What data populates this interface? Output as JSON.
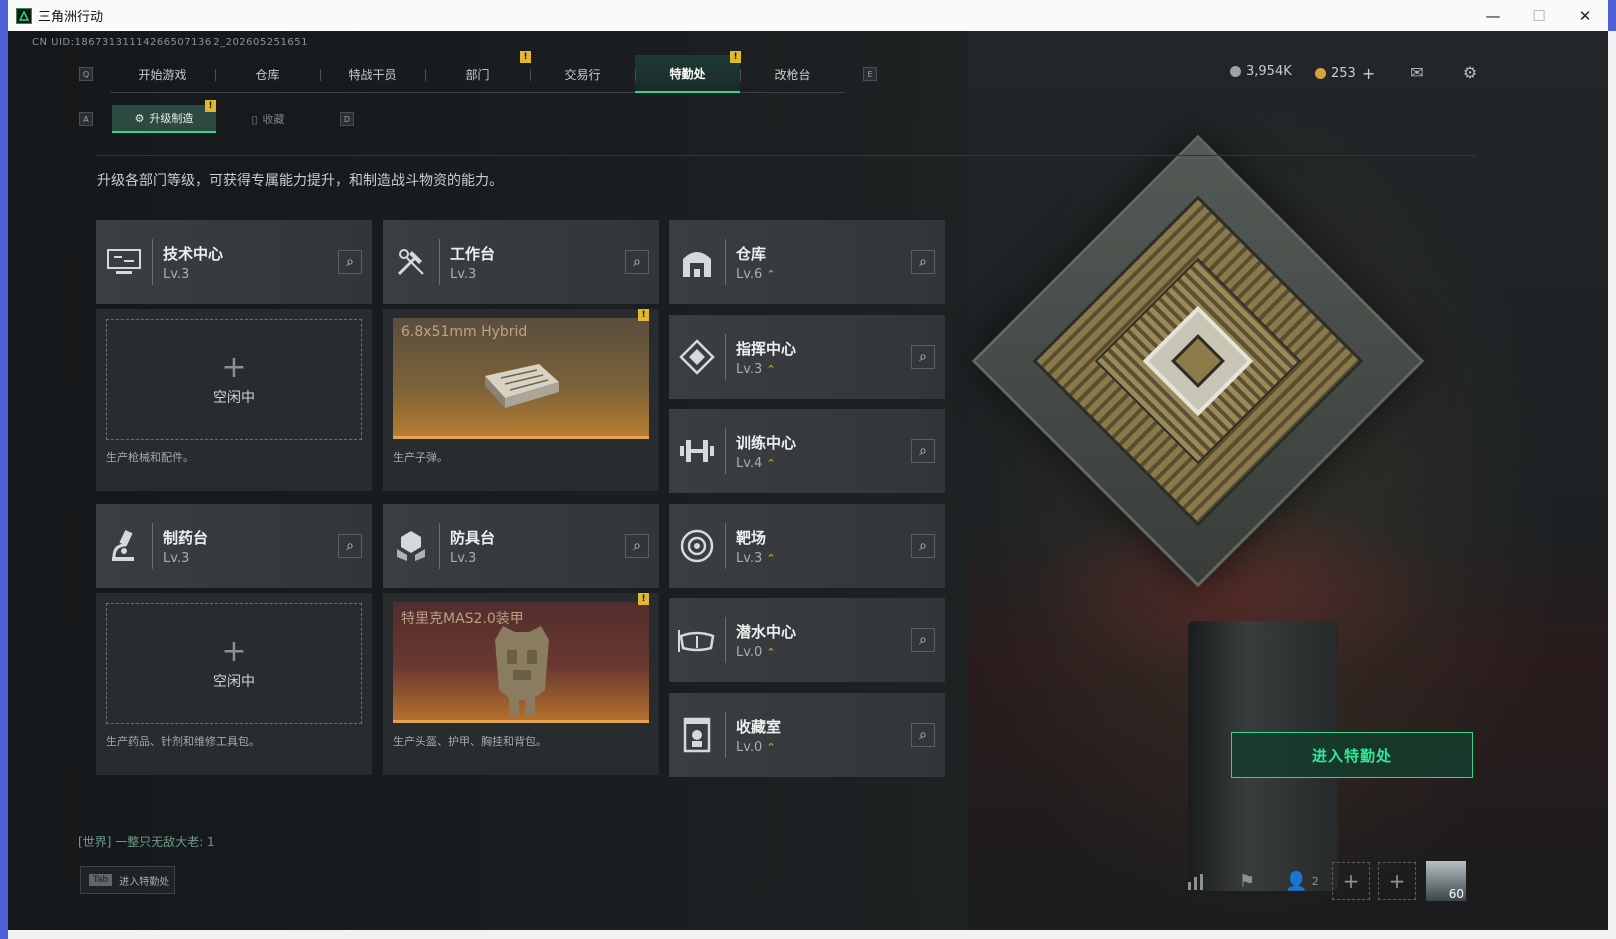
{
  "window": {
    "title": "三角洲行动",
    "minimize": "—",
    "maximize": "☐",
    "close": "✕"
  },
  "uid": "CN UID:18673131114266507136 2_202605251651",
  "nav": {
    "key_left": "Q",
    "key_right": "E",
    "tabs": [
      {
        "label": "开始游戏"
      },
      {
        "label": "仓库"
      },
      {
        "label": "特战干员"
      },
      {
        "label": "部门"
      },
      {
        "label": "交易行"
      },
      {
        "label": "特勤处"
      },
      {
        "label": "改枪台"
      }
    ]
  },
  "currency": {
    "coins": "3,954K",
    "tokens": "253",
    "add": "+"
  },
  "subnav": {
    "key_left": "A",
    "key_right": "D",
    "active": "升级制造",
    "other": "收藏"
  },
  "description": "升级各部门等级，可获得专属能力提升，和制造战斗物资的能力。",
  "facilities": [
    {
      "name": "技术中心",
      "level": "Lv.3",
      "icon": "monitor-icon"
    },
    {
      "name": "工作台",
      "level": "Lv.3",
      "icon": "tools-icon"
    },
    {
      "name": "仓库",
      "level": "Lv.6",
      "icon": "warehouse-icon",
      "upgradable": "⌃"
    },
    {
      "name": "指挥中心",
      "level": "Lv.3",
      "icon": "command-icon",
      "upgradable": "⌃"
    },
    {
      "name": "训练中心",
      "level": "Lv.4",
      "icon": "dumbbell-icon",
      "upgradable": "⌃"
    },
    {
      "name": "制药台",
      "level": "Lv.3",
      "icon": "microscope-icon"
    },
    {
      "name": "防具台",
      "level": "Lv.3",
      "icon": "armor-icon"
    },
    {
      "name": "靶场",
      "level": "Lv.3",
      "icon": "target-icon",
      "upgradable": "⌃"
    },
    {
      "name": "潜水中心",
      "level": "Lv.0",
      "icon": "diving-icon",
      "upgradable": "⌃"
    },
    {
      "name": "收藏室",
      "level": "Lv.0",
      "icon": "collection-icon",
      "upgradable": "⌃"
    }
  ],
  "slots": {
    "tech": {
      "status": "空闲中",
      "caption": "生产枪械和配件。"
    },
    "workbench": {
      "item": "6.8x51mm Hybrid",
      "caption": "生产子弹。"
    },
    "pharmacy": {
      "status": "空闲中",
      "caption": "生产药品、针剂和维修工具包。"
    },
    "armor": {
      "item": "特里克MAS2.0装甲",
      "caption": "生产头盔、护甲、胸挂和背包。"
    }
  },
  "alert_mark": "!",
  "chat": {
    "channel": "[世界]",
    "message": "一整只无敌大老: 1"
  },
  "tab_hint": {
    "key": "Tab",
    "label": "进入特勤处"
  },
  "enter_button": "进入特勤处",
  "bottom": {
    "friends_count": "2",
    "level": "60"
  },
  "colors": {
    "accent": "#2fd58a",
    "alert": "#e0b92c",
    "coins": "#9aa3a6",
    "tokens": "#d7a23c"
  }
}
